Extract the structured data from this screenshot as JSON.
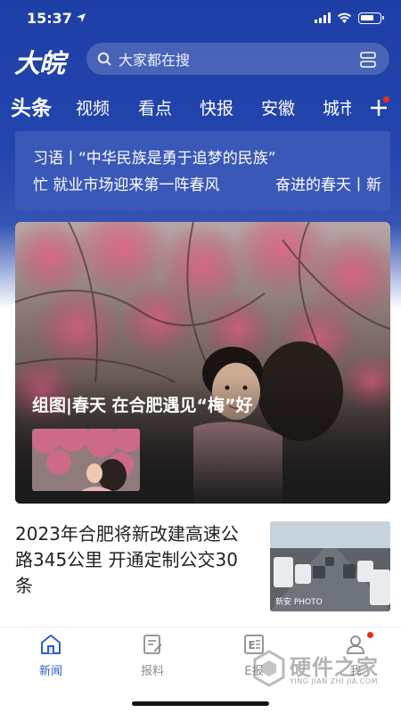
{
  "status_bar": {
    "time": "15:37"
  },
  "header": {
    "logo_text": "大皖",
    "search": {
      "placeholder": "大家都在搜"
    }
  },
  "tabs": [
    {
      "label": "头条",
      "active": true
    },
    {
      "label": "视频"
    },
    {
      "label": "看点"
    },
    {
      "label": "快报"
    },
    {
      "label": "安徽"
    },
    {
      "label": "城市"
    }
  ],
  "ticker": {
    "line1": "习语丨“中华民族是勇于追梦的民族”",
    "line2_left": "忙 就业市场迎来第一阵春风",
    "line2_right": "奋进的春天丨新"
  },
  "hero": {
    "title": "组图|春天 在合肥遇见“梅”好"
  },
  "article": {
    "title": "2023年合肥将新改建高速公路345公里 开通定制公交30条",
    "image_watermark": "新安 PHOTO"
  },
  "bottom_nav": [
    {
      "label": "新闻",
      "icon": "home-icon",
      "active": true
    },
    {
      "label": "报料",
      "icon": "edit-report-icon"
    },
    {
      "label": "E报",
      "icon": "e-paper-icon"
    },
    {
      "label": "我",
      "icon": "profile-icon"
    }
  ],
  "watermark": {
    "brand": "硬件之家",
    "sub": "YING JIAN ZHI JIA.COM"
  },
  "colors": {
    "brand_blue": "#1e3fa6",
    "accent": "#2a5dd6",
    "dot_red": "#e6301f"
  }
}
